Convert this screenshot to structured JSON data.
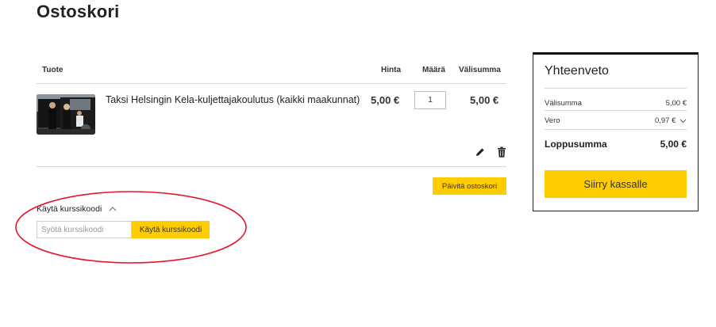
{
  "page": {
    "title": "Ostoskori"
  },
  "cart": {
    "columns": {
      "product": "Tuote",
      "price": "Hinta",
      "quantity": "Määrä",
      "subtotal": "Välisumma"
    },
    "items": [
      {
        "name": "Taksi Helsingin Kela-kuljettajakoulutus (kaikki maakunnat)",
        "price": "5,00 €",
        "quantity": "1",
        "subtotal": "5,00 €",
        "edit_icon": "pencil-icon",
        "delete_icon": "trash-icon"
      }
    ],
    "update_button": "Päivitä ostoskori"
  },
  "coupon": {
    "toggle_label": "Käytä kurssikoodi",
    "toggle_icon": "chevron-up-icon",
    "input_placeholder": "Syötä kurssikoodi",
    "apply_button": "Käytä kurssikoodi",
    "highlight_color": "#e0192b"
  },
  "summary": {
    "title": "Yhteenveto",
    "subtotal_label": "Välisumma",
    "subtotal_value": "5,00 €",
    "tax_label": "Vero",
    "tax_value": "0,97 €",
    "tax_icon": "chevron-down-icon",
    "total_label": "Loppusumma",
    "total_value": "5,00 €",
    "checkout_button": "Siirry kassalle"
  },
  "colors": {
    "accent": "#ffcc00",
    "text": "#222222",
    "divider": "#d6d6d6"
  }
}
